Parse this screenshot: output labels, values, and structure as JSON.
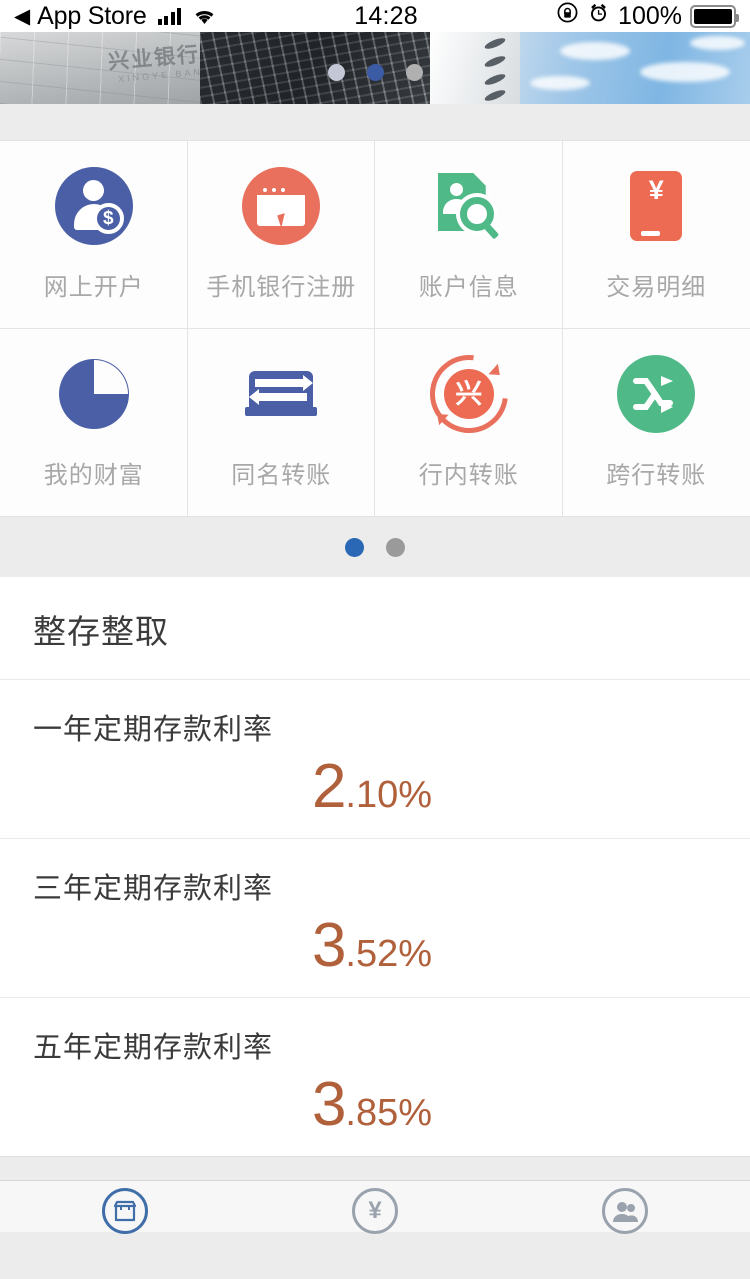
{
  "statusbar": {
    "back_label": "App Store",
    "back_arrow": "◀",
    "signal_icon": "cellular-signal-icon",
    "wifi_icon": "wifi-icon",
    "time": "14:28",
    "rotation_lock_icon": "rotation-lock-icon",
    "alarm_icon": "alarm-clock-icon",
    "battery_percent": "100%",
    "battery_icon": "battery-full-icon"
  },
  "banner": {
    "logo_cn": "兴业银行",
    "logo_en": "XINGYE BANK",
    "dots": [
      {
        "name": "banner-dot-1",
        "active": false,
        "color": "#c3c7d6"
      },
      {
        "name": "banner-dot-2",
        "active": true,
        "color": "#3b5ba5"
      },
      {
        "name": "banner-dot-3",
        "active": false,
        "color": "#b0b0b0"
      }
    ]
  },
  "grid": {
    "items": [
      {
        "label": "网上开户",
        "icon": "online-account-opening-icon",
        "color": "#4a5fa5"
      },
      {
        "label": "手机银行注册",
        "icon": "mobile-bank-register-icon",
        "color": "#e8705c"
      },
      {
        "label": "账户信息",
        "icon": "account-info-icon",
        "color": "#4fba87"
      },
      {
        "label": "交易明细",
        "icon": "transaction-detail-icon",
        "color": "#ed6a53"
      },
      {
        "label": "我的财富",
        "icon": "my-wealth-pie-icon",
        "color": "#4a5fa5"
      },
      {
        "label": "同名转账",
        "icon": "same-name-transfer-icon",
        "color": "#4a5fa5"
      },
      {
        "label": "行内转账",
        "icon": "in-bank-transfer-icon",
        "color": "#ed6a53",
        "glyph": "兴"
      },
      {
        "label": "跨行转账",
        "icon": "cross-bank-transfer-icon",
        "color": "#4fba87"
      }
    ],
    "page_dots": [
      {
        "name": "grid-page-dot-1",
        "active": true,
        "color": "#2a68b5"
      },
      {
        "name": "grid-page-dot-2",
        "active": false,
        "color": "#9a9a9a"
      }
    ]
  },
  "rates": {
    "section_title": "整存整取",
    "accent_color": "#b0603a",
    "rows": [
      {
        "name": "一年定期存款利率",
        "integer": "2",
        "decimal": ".10%",
        "value": 2.1
      },
      {
        "name": "三年定期存款利率",
        "integer": "3",
        "decimal": ".52%",
        "value": 3.52
      },
      {
        "name": "五年定期存款利率",
        "integer": "3",
        "decimal": ".85%",
        "value": 3.85
      }
    ]
  },
  "tabbar": {
    "tabs": [
      {
        "icon": "store-home-icon",
        "active": true,
        "color": "#3f6ea8"
      },
      {
        "icon": "yen-money-icon",
        "active": false,
        "color": "#9aa3ad",
        "glyph": "¥"
      },
      {
        "icon": "people-icon",
        "active": false,
        "color": "#9aa3ad"
      }
    ]
  }
}
